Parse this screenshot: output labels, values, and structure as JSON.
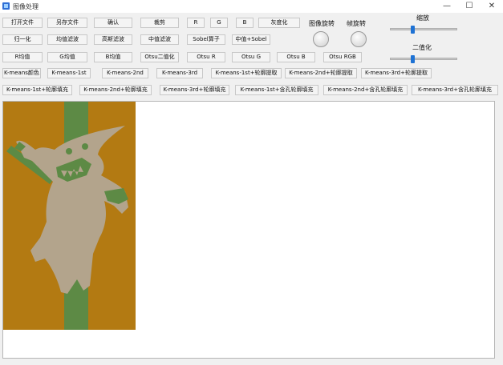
{
  "window": {
    "title": "图像处理",
    "minimize": "—",
    "maximize": "☐",
    "close": "✕"
  },
  "row1": [
    "打开文件",
    "另存文件",
    "确认",
    "裁剪",
    "R",
    "G",
    "B",
    "灰度化"
  ],
  "row2": [
    "归一化",
    "均值滤波",
    "高斯滤波",
    "中值滤波",
    "Sobel算子",
    "中值+Sobel"
  ],
  "row3": [
    "R均值",
    "G均值",
    "B均值",
    "Otsu二值化",
    "Otsu R",
    "Otsu G",
    "Otsu B",
    "Otsu RGB"
  ],
  "row4": [
    "K-means颜色",
    "K-means-1st",
    "K-means-2nd",
    "K-means-3rd",
    "K-means-1st+轮廓提取",
    "K-means-2nd+轮廓提取",
    "K-means-3rd+轮廓提取"
  ],
  "row5": [
    "K-means-1st+轮廓填充",
    "K-means-2nd+轮廓填充",
    "K-means-3rd+轮廓填充",
    "K-means-1st+含孔轮廓填充",
    "K-means-2nd+含孔轮廓填充",
    "K-means-3rd+含孔轮廓填充"
  ],
  "rotate": {
    "image_label": "图像旋转",
    "frame_label": "帧旋转"
  },
  "sliders": {
    "zoom": {
      "label": "缩放",
      "value": 0.33
    },
    "binarize": {
      "label": "二值化",
      "value": 0.33
    }
  },
  "colors": {
    "background": "#b37a12",
    "stripe": "#5d8a45",
    "figure": "#b3a48c",
    "accent": "#1e72d4"
  }
}
